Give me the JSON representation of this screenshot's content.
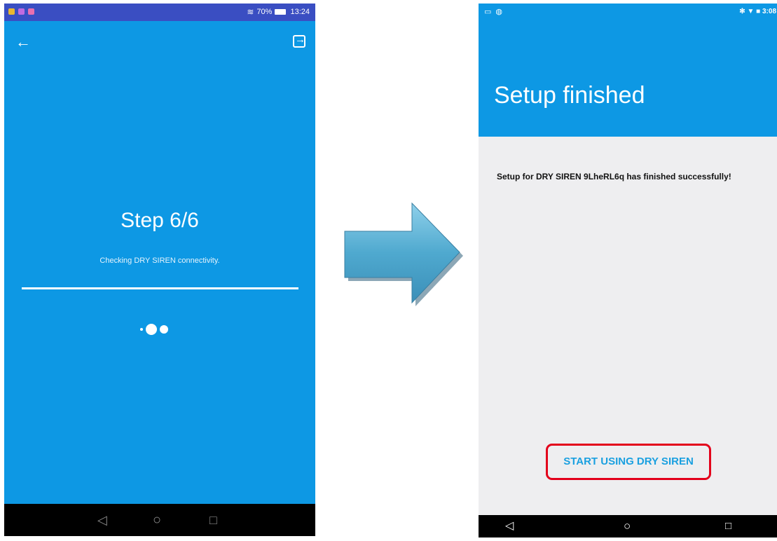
{
  "left_screen": {
    "status": {
      "battery": "70%",
      "time": "13:24",
      "wifi_icon": "wifi-icon",
      "battery_icon": "battery-icon",
      "app_dots_colors": [
        "#e9b730",
        "#c06be0",
        "#e86fb0"
      ]
    },
    "toolbar": {
      "back_icon": "arrow-left-icon",
      "exit_icon": "exit-icon"
    },
    "step_title": "Step 6/6",
    "step_description": "Checking DRY SIREN connectivity.",
    "progress": 1.0,
    "loader_icon": "loading-dots-icon",
    "navbar": {
      "back": "◁",
      "home": "○",
      "recent": "□"
    },
    "colors": {
      "background": "#0d98e4",
      "statusbar": "#3a4ec2"
    }
  },
  "arrow": {
    "icon": "right-arrow-icon",
    "color": "#5ab2d6"
  },
  "right_screen": {
    "status": {
      "time": "3:08",
      "left_icons": [
        "notification-icon",
        "android-icon"
      ],
      "right_icons": [
        "bluetooth-icon",
        "wifi-icon",
        "battery-icon"
      ]
    },
    "title": "Setup finished",
    "message": "Setup for DRY SIREN 9LheRL6q has finished successfully!",
    "start_button_label": "START USING DRY SIREN",
    "navbar": {
      "back": "◁",
      "home": "○",
      "recent": "□"
    },
    "colors": {
      "header": "#0d98e4",
      "body": "#eeeef0",
      "button_text": "#1aa0e0",
      "highlight": "#e3001b"
    }
  }
}
